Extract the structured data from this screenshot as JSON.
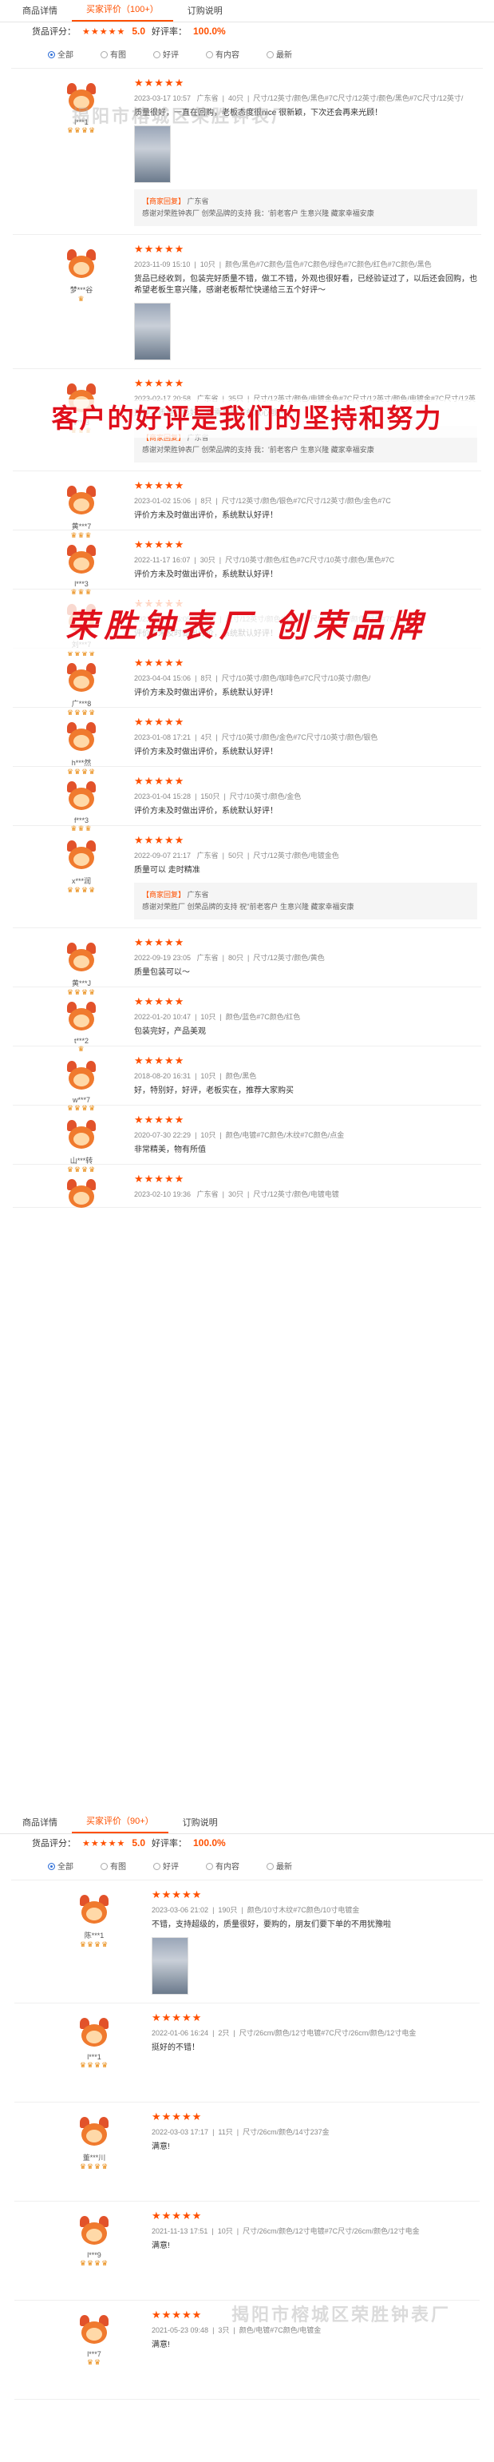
{
  "tabs": {
    "detail": "商品详情",
    "reviews": "买家评价（100+）",
    "notes": "订购说明"
  },
  "score": {
    "label": "货品评分：",
    "stars": "★★★★★",
    "value": "5.0",
    "good_label": "好评率：",
    "good_rate": "100.0%",
    "rating": 5.0
  },
  "filters": [
    "全部",
    "有图",
    "好评",
    "有内容",
    "最新"
  ],
  "watermarks": {
    "w1": "揭阳市榕城区荣胜钟表厂",
    "w2": "揭阳市榕城区荣胜钟表厂"
  },
  "banners": {
    "b1": "客户的好评是我们的坚持和努力",
    "b2": "荣胜钟表厂 创荣品牌"
  },
  "icons": {
    "star": "star-icon",
    "badge": "crown-badge-icon",
    "avatar": "cat-avatar-icon"
  },
  "colors": {
    "accent": "#ff5000",
    "banner": "#e0101c",
    "badge": "#e98a10"
  },
  "reviews": [
    {
      "user": "l***1",
      "stars": "★★★★★",
      "badges": "♛♛♛♛",
      "date": "2023-03-17 10:57",
      "region": "广东省",
      "qty": "40只",
      "spec": "尺寸/12英寸/颜色/黑色#7C尺寸/12英寸/颜色/黑色#7C尺寸/12英寸/",
      "text": "质量很好，一直在回购，老板态度很nice 很新颖，下次还会再来光顾！",
      "reply_label": "【商家回复】",
      "reply_region": "广东省",
      "reply": "感谢对荣胜钟表厂 创荣品牌的支持 我：'前老客户 生意兴隆 藏家幸福安康"
    },
    {
      "user": "梦***谷",
      "stars": "★★★★★",
      "badges": "♛",
      "date": "2023-11-09 15:10",
      "region": "",
      "qty": "10只",
      "spec": "颜色/黑色#7C颜色/蓝色#7C颜色/绿色#7C颜色/红色#7C颜色/黑色",
      "text": "货品已经收到，包装完好质量不错，做工不错，外观也很好看，已经验证过了，以后还会回购，也希望老板生意兴隆，感谢老板帮忙快递给三五个好评～",
      "reply_label": "",
      "reply_region": "",
      "reply": ""
    },
    {
      "user": "v***3",
      "stars": "★★★★★",
      "badges": "♛♛♛",
      "date": "2023-02-17 20:58",
      "region": "广东省",
      "qty": "35只",
      "spec": "尺寸/12英寸/颜色/电镀金色#7C尺寸/12英寸/颜色/电镀金#7C尺寸/12英",
      "text": "那种，质量红杉好，有需要的下单放心哦～",
      "reply_label": "【商家回复】",
      "reply_region": "广东省",
      "reply": "感谢对荣胜钟表厂 创荣品牌的支持 我：'前老客户 生意兴隆 藏家幸福安康"
    },
    {
      "user": "黄***7",
      "stars": "★★★★★",
      "badges": "♛♛♛",
      "date": "2023-01-02 15:06",
      "region": "",
      "qty": "8只",
      "spec": "尺寸/12英寸/颜色/银色#7C尺寸/12英寸/颜色/金色#7C",
      "text": "评价方未及时做出评价，系统默认好评！",
      "reply_label": "",
      "reply_region": "",
      "reply": ""
    },
    {
      "user": "l***3",
      "stars": "★★★★★",
      "badges": "♛♛♛",
      "date": "2022-11-17 16:07",
      "region": "",
      "qty": "30只",
      "spec": "尺寸/10英寸/颜色/红色#7C尺寸/10英寸/颜色/黑色#7C",
      "text": "评价方未及时做出评价，系统默认好评！",
      "reply_label": "",
      "reply_region": "",
      "reply": ""
    },
    {
      "user": "刘***7",
      "stars": "★★★★★",
      "badges": "♛♛♛♛",
      "date": "2023-04-05 16:05",
      "region": "",
      "qty": "30只",
      "spec": "尺寸/12英寸/颜色/红色#7C尺寸/12英寸/颜色/绿色#7C",
      "text": "评价方未及时做出评价，系统默认好评！",
      "reply_label": "",
      "reply_region": "",
      "reply": ""
    },
    {
      "user": "广***8",
      "stars": "★★★★★",
      "badges": "♛♛♛♛",
      "date": "2023-04-04 15:06",
      "region": "",
      "qty": "8只",
      "spec": "尺寸/10英寸/颜色/咖啡色#7C尺寸/10英寸/颜色/",
      "text": "评价方未及时做出评价，系统默认好评！",
      "reply_label": "",
      "reply_region": "",
      "reply": ""
    },
    {
      "user": "h***然",
      "stars": "★★★★★",
      "badges": "♛♛♛♛",
      "date": "2023-01-08 17:21",
      "region": "",
      "qty": "4只",
      "spec": "尺寸/10英寸/颜色/金色#7C尺寸/10英寸/颜色/银色",
      "text": "评价方未及时做出评价，系统默认好评！",
      "reply_label": "",
      "reply_region": "",
      "reply": ""
    },
    {
      "user": "f***3",
      "stars": "★★★★★",
      "badges": "♛♛♛",
      "date": "2023-01-04 15:28",
      "region": "",
      "qty": "150只",
      "spec": "尺寸/10英寸/颜色/金色",
      "text": "评价方未及时做出评价，系统默认好评！",
      "reply_label": "",
      "reply_region": "",
      "reply": ""
    },
    {
      "user": "x***润",
      "stars": "★★★★★",
      "badges": "♛♛♛♛",
      "date": "2022-09-07 21:17",
      "region": "广东省",
      "qty": "50只",
      "spec": "尺寸/12英寸/颜色/电镀金色",
      "text": "质量可以 走时精准",
      "reply_label": "【商家回复】",
      "reply_region": "广东省",
      "reply": "感谢对荣胜厂 创荣品牌的支持 祝''前老客户 生意兴隆 藏家幸福安康"
    },
    {
      "user": "黄***J",
      "stars": "★★★★★",
      "badges": "♛♛♛♛",
      "date": "2022-09-19 23:05",
      "region": "广东省",
      "qty": "80只",
      "spec": "尺寸/12英寸/颜色/黄色",
      "text": "质量包装可以～",
      "reply_label": "",
      "reply_region": "",
      "reply": ""
    },
    {
      "user": "t***2",
      "stars": "★★★★★",
      "badges": "♛",
      "date": "2022-01-20 10:47",
      "region": "",
      "qty": "10只",
      "spec": "颜色/蓝色#7C颜色/红色",
      "text": "包装完好，产品美观",
      "reply_label": "",
      "reply_region": "",
      "reply": ""
    },
    {
      "user": "w***7",
      "stars": "★★★★★",
      "badges": "♛♛♛♛",
      "date": "2018-08-20 16:31",
      "region": "",
      "qty": "10只",
      "spec": "颜色/黑色",
      "text": "好，特别好，好评，老板实在，推荐大家购买",
      "reply_label": "",
      "reply_region": "",
      "reply": ""
    },
    {
      "user": "山***转",
      "stars": "★★★★★",
      "badges": "♛♛♛♛",
      "date": "2020-07-30 22:29",
      "region": "",
      "qty": "10只",
      "spec": "颜色/电镀#7C颜色/木纹#7C颜色/点金",
      "text": "非常精美，物有所值",
      "reply_label": "",
      "reply_region": "",
      "reply": ""
    },
    {
      "user": "",
      "stars": "★★★★★",
      "badges": "",
      "date": "2023-02-10 19:36",
      "region": "广东省",
      "qty": "30只",
      "spec": "尺寸/12英寸/颜色/电镀电镀",
      "text": "",
      "reply_label": "",
      "reply_region": "",
      "reply": ""
    }
  ],
  "section2": {
    "tabs": {
      "detail": "商品详情",
      "reviews": "买家评价（90+）",
      "notes": "订购说明"
    },
    "score": {
      "label": "货品评分：",
      "stars": "★★★★★",
      "value": "5.0",
      "good_label": "好评率：",
      "good_rate": "100.0%",
      "rating": 5.0
    },
    "filters": [
      "全部",
      "有图",
      "好评",
      "有内容",
      "最新"
    ],
    "reviews": [
      {
        "user": "陈***1",
        "stars": "★★★★★",
        "badges": "♛♛♛♛",
        "date": "2023-03-06 21:02",
        "region": "",
        "qty": "190只",
        "spec": "颜色/10寸木纹#7C颜色/10寸电镀金",
        "text": "不错，支持超级的，质量很好，要购的，朋友们要下单的不用犹豫啦"
      },
      {
        "user": "l***1",
        "stars": "★★★★★",
        "badges": "♛♛♛♛",
        "date": "2022-01-06 16:24",
        "region": "",
        "qty": "2只",
        "spec": "尺寸/26cm/颜色/12寸电镀#7C尺寸/26cm/颜色/12寸电金",
        "text": "挺好的不错！"
      },
      {
        "user": "董***川",
        "stars": "★★★★★",
        "badges": "♛♛♛♛",
        "date": "2022-03-03 17:17",
        "region": "",
        "qty": "11只",
        "spec": "尺寸/26cm/颜色/14寸237金",
        "text": "满意!"
      },
      {
        "user": "l***9",
        "stars": "★★★★★",
        "badges": "♛♛♛♛",
        "date": "2021-11-13 17:51",
        "region": "",
        "qty": "10只",
        "spec": "尺寸/26cm/颜色/12寸电镀#7C尺寸/26cm/颜色/12寸电金",
        "text": "满意!"
      },
      {
        "user": "l***7",
        "stars": "★★★★★",
        "badges": "♛♛",
        "date": "2021-05-23 09:48",
        "region": "",
        "qty": "3只",
        "spec": "颜色/电镀#7C颜色/电镀金",
        "text": "满意!"
      }
    ]
  }
}
